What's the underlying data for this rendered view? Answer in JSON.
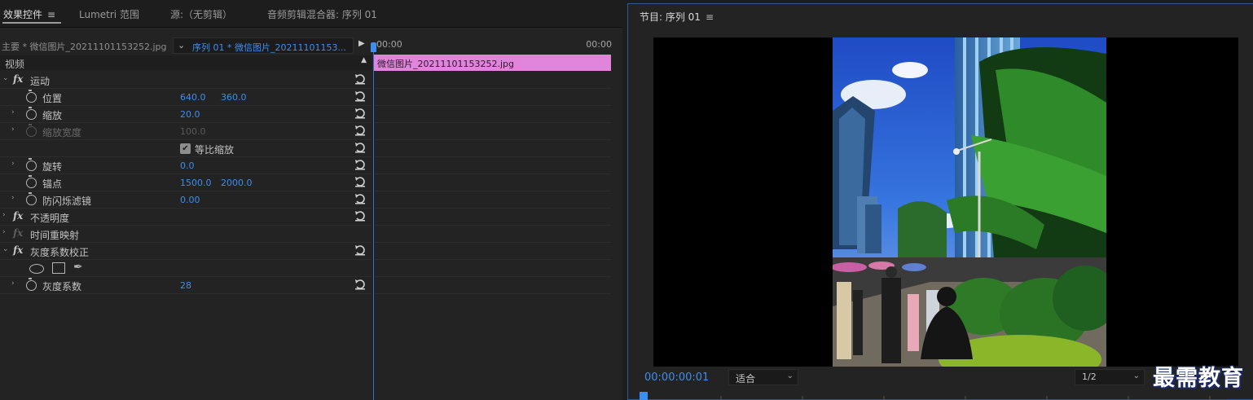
{
  "tabs": {
    "effects": "效果控件",
    "lumetri": "Lumetri 范围",
    "source": "源:（无剪辑）",
    "mixer": "音频剪辑混合器: 序列 01"
  },
  "effects_panel": {
    "source_label": "主要 * 微信图片_20211101153252.jpg",
    "sequence_label": "序列 01 * 微信图片_20211101153...",
    "ruler_start": "00:00",
    "ruler_end": "00:00",
    "clip_name": "微信图片_20211101153252.jpg",
    "video_label": "视频",
    "motion": "运动",
    "position": {
      "label": "位置",
      "x": "640.0",
      "y": "360.0"
    },
    "scale": {
      "label": "缩放",
      "value": "20.0"
    },
    "scale_width": {
      "label": "缩放宽度",
      "value": "100.0"
    },
    "uniform_scale": {
      "label": "等比缩放",
      "checked": true
    },
    "rotation": {
      "label": "旋转",
      "value": "0.0"
    },
    "anchor": {
      "label": "锚点",
      "x": "1500.0",
      "y": "2000.0"
    },
    "flicker": {
      "label": "防闪烁滤镜",
      "value": "0.00"
    },
    "opacity": "不透明度",
    "time_remap": "时间重映射",
    "gamma": "灰度系数校正",
    "gamma_value": {
      "label": "灰度系数",
      "value": "28"
    },
    "fx_symbol": "fx"
  },
  "program": {
    "title": "节目: 序列 01",
    "timecode": "00:00:00:01",
    "fit": "适合",
    "resolution": "1/2",
    "watermark": "最需教育"
  },
  "colors": {
    "accent": "#3d8ef0",
    "clip": "#e184dc",
    "panel": "#232323"
  }
}
